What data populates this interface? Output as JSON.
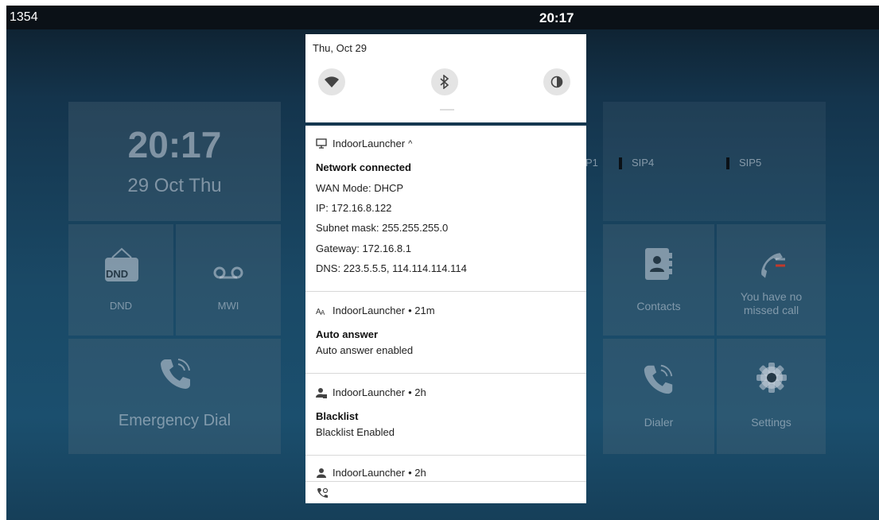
{
  "status_bar": {
    "left_text": "1354",
    "time": "20:17"
  },
  "home": {
    "clock_time": "20:17",
    "clock_date": "29 Oct Thu",
    "dnd_badge": "DND",
    "dnd_label": "DND",
    "mwi_label": "MWI",
    "emergency_label": "Emergency Dial",
    "sip_accounts": [
      "P1",
      "SIP4",
      "SIP5"
    ],
    "contacts_label": "Contacts",
    "missed_call_text": "You have no missed call",
    "dialer_label": "Dialer",
    "settings_label": "Settings"
  },
  "quick_settings": {
    "date": "Thu, Oct 29",
    "toggles": [
      {
        "icon": "wifi-icon"
      },
      {
        "icon": "bluetooth-icon"
      },
      {
        "icon": "invert-colors-icon"
      }
    ]
  },
  "notifications": [
    {
      "app": "IndoorLauncher",
      "time_suffix": "^",
      "icon": "monitor-icon",
      "title": "Network connected",
      "lines": [
        "WAN Mode: DHCP",
        "IP: 172.16.8.122",
        "Subnet mask: 255.255.255.0",
        "Gateway: 172.16.8.1",
        "DNS: 223.5.5.5, 114.114.114.114"
      ]
    },
    {
      "app": "IndoorLauncher",
      "time_suffix": "• 21m",
      "icon": "translate-icon",
      "title": "Auto answer",
      "lines": [
        "Auto answer enabled"
      ]
    },
    {
      "app": "IndoorLauncher",
      "time_suffix": "• 2h",
      "icon": "blacklist-user-icon",
      "title": "Blacklist",
      "lines": [
        "Blacklist Enabled"
      ]
    },
    {
      "app": "IndoorLauncher",
      "time_suffix": "• 2h",
      "icon": "user-icon",
      "title": "",
      "lines": []
    }
  ],
  "colors": {
    "status_bar_bg": "#0b1117",
    "panel_bg": "#ffffff",
    "missed_call_red": "#c0392b"
  }
}
